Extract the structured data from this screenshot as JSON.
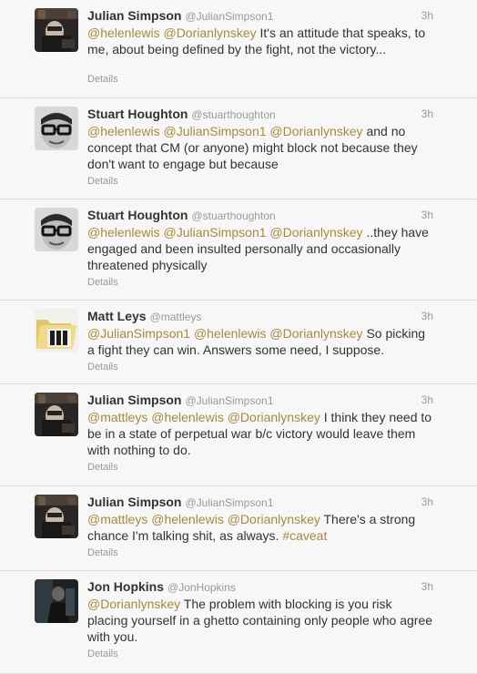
{
  "tweets": [
    {
      "name": "Julian Simpson",
      "handle": "@JulianSimpson1",
      "time": "3h",
      "avatar": "julian-avatar",
      "parts": [
        {
          "t": "mention",
          "v": "@helenlewis"
        },
        {
          "t": "text",
          "v": " "
        },
        {
          "t": "mention",
          "v": "@Dorianlynskey"
        },
        {
          "t": "text",
          "v": " It's an attitude that speaks, to me, about being defined by the fight, not the victory..."
        }
      ],
      "details": "Details"
    },
    {
      "name": "Stuart Houghton",
      "handle": "@stuarthoughton",
      "time": "3h",
      "avatar": "stuart-avatar",
      "parts": [
        {
          "t": "mention",
          "v": "@helenlewis"
        },
        {
          "t": "text",
          "v": " "
        },
        {
          "t": "mention",
          "v": "@JulianSimpson1"
        },
        {
          "t": "text",
          "v": " "
        },
        {
          "t": "mention",
          "v": "@Dorianlynskey"
        },
        {
          "t": "text",
          "v": " and no concept that CM (or anyone) might block not because they don't want to engage but because"
        }
      ],
      "details": "Details"
    },
    {
      "name": "Stuart Houghton",
      "handle": "@stuarthoughton",
      "time": "3h",
      "avatar": "stuart-avatar",
      "parts": [
        {
          "t": "mention",
          "v": "@helenlewis"
        },
        {
          "t": "text",
          "v": " "
        },
        {
          "t": "mention",
          "v": "@JulianSimpson1"
        },
        {
          "t": "text",
          "v": " "
        },
        {
          "t": "mention",
          "v": "@Dorianlynskey"
        },
        {
          "t": "text",
          "v": " ..they have engaged and been insulted personally and occasionally threatened physically"
        }
      ],
      "details": "Details"
    },
    {
      "name": "Matt Leys",
      "handle": "@mattleys",
      "time": "3h",
      "avatar": "folder-avatar",
      "parts": [
        {
          "t": "mention",
          "v": "@JulianSimpson1"
        },
        {
          "t": "text",
          "v": " "
        },
        {
          "t": "mention",
          "v": "@helenlewis"
        },
        {
          "t": "text",
          "v": " "
        },
        {
          "t": "mention",
          "v": "@Dorianlynskey"
        },
        {
          "t": "text",
          "v": " So picking a fight they can win. Answers some need, I suppose."
        }
      ],
      "details": "Details"
    },
    {
      "name": "Julian Simpson",
      "handle": "@JulianSimpson1",
      "time": "3h",
      "avatar": "julian-avatar",
      "parts": [
        {
          "t": "mention",
          "v": "@mattleys"
        },
        {
          "t": "text",
          "v": " "
        },
        {
          "t": "mention",
          "v": "@helenlewis"
        },
        {
          "t": "text",
          "v": " "
        },
        {
          "t": "mention",
          "v": "@Dorianlynskey"
        },
        {
          "t": "text",
          "v": " I think they need to be in a state of perpetual war b/c victory would leave them with nothing to do."
        }
      ],
      "details": "Details"
    },
    {
      "name": "Julian Simpson",
      "handle": "@JulianSimpson1",
      "time": "3h",
      "avatar": "julian-avatar",
      "parts": [
        {
          "t": "mention",
          "v": "@mattleys"
        },
        {
          "t": "text",
          "v": " "
        },
        {
          "t": "mention",
          "v": "@helenlewis"
        },
        {
          "t": "text",
          "v": " "
        },
        {
          "t": "mention",
          "v": "@Dorianlynskey"
        },
        {
          "t": "text",
          "v": " There's a strong chance I'm talking shit, as always. "
        },
        {
          "t": "hashtag",
          "v": "#caveat"
        }
      ],
      "details": "Details"
    },
    {
      "name": "Jon Hopkins",
      "handle": "@JonHopkins",
      "time": "3h",
      "avatar": "jon-avatar",
      "parts": [
        {
          "t": "mention",
          "v": "@Dorianlynskey"
        },
        {
          "t": "text",
          "v": " The problem with blocking is you risk placing yourself in a ghetto containing only people who agree with you."
        }
      ],
      "details": "Details"
    }
  ],
  "colors": {
    "link": "#a48b3d",
    "text": "#333333",
    "meta": "#999999",
    "background": "#f7f7f7"
  }
}
